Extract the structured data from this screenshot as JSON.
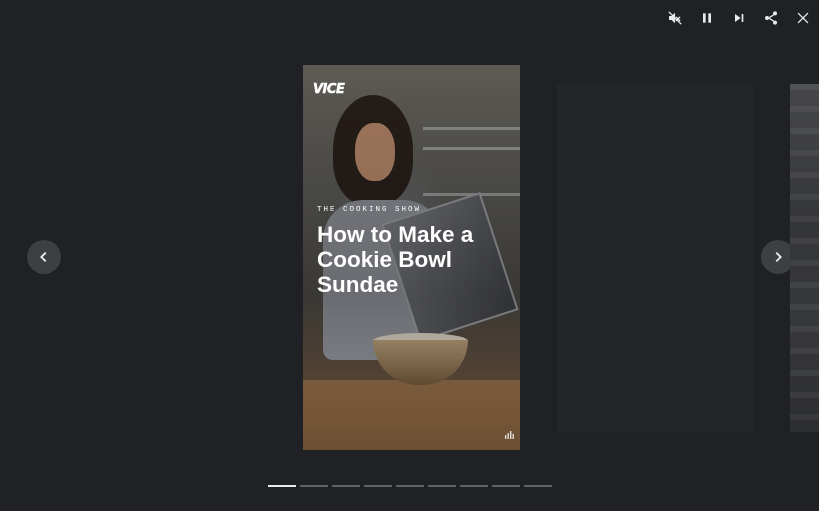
{
  "controls": {
    "icons": [
      "mute-icon",
      "pause-icon",
      "skip-next-icon",
      "share-icon",
      "close-icon"
    ]
  },
  "navigation": {
    "prev_icon": "chevron-left-icon",
    "next_icon": "chevron-right-icon"
  },
  "story": {
    "brand": "VICE",
    "kicker": "THE COOKING SHOW",
    "headline": "How to Make a Cookie Bowl Sundae",
    "corner_icon": "bars-icon"
  },
  "progress": {
    "segments": 9,
    "active_index": 0
  },
  "colors": {
    "background": "#202124",
    "icon": "#e8eaed",
    "nav_button": "#3c4043",
    "progress_active": "#e8eaed",
    "progress_inactive": "#5f6368"
  }
}
